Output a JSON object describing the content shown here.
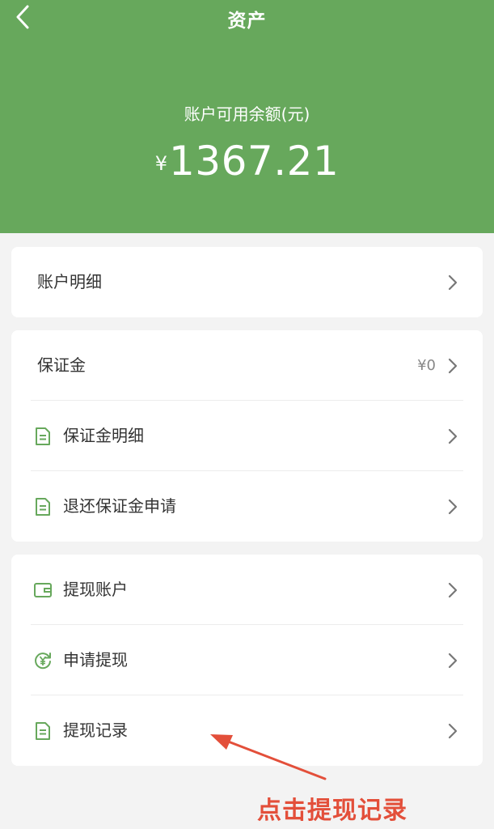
{
  "header": {
    "title": "资产",
    "balance_label": "账户可用余额(元)",
    "currency_symbol": "¥",
    "balance_amount": "1367.21",
    "bg_color": "#67a85c"
  },
  "account_detail": {
    "label": "账户明细"
  },
  "deposit": {
    "label": "保证金",
    "value": "¥0",
    "items": [
      {
        "label": "保证金明细",
        "icon": "document-icon"
      },
      {
        "label": "退还保证金申请",
        "icon": "document-icon"
      }
    ]
  },
  "withdraw": {
    "items": [
      {
        "label": "提现账户",
        "icon": "wallet-icon"
      },
      {
        "label": "申请提现",
        "icon": "yen-refresh-icon"
      },
      {
        "label": "提现记录",
        "icon": "document-icon"
      }
    ]
  },
  "annotation": {
    "text": "点击提现记录",
    "color": "#e34f3a"
  }
}
